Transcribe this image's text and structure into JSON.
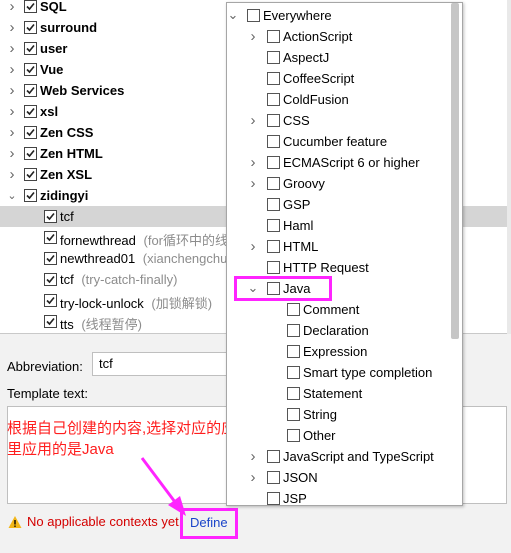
{
  "tree": {
    "items": [
      {
        "label": "SQL",
        "bold": true,
        "checked": true,
        "expanded": false
      },
      {
        "label": "surround",
        "bold": true,
        "checked": true,
        "expanded": false
      },
      {
        "label": "user",
        "bold": true,
        "checked": true,
        "expanded": false
      },
      {
        "label": "Vue",
        "bold": true,
        "checked": true,
        "expanded": false
      },
      {
        "label": "Web Services",
        "bold": true,
        "checked": true,
        "expanded": false
      },
      {
        "label": "xsl",
        "bold": true,
        "checked": true,
        "expanded": false
      },
      {
        "label": "Zen CSS",
        "bold": true,
        "checked": true,
        "expanded": false
      },
      {
        "label": "Zen HTML",
        "bold": true,
        "checked": true,
        "expanded": false
      },
      {
        "label": "Zen XSL",
        "bold": true,
        "checked": true,
        "expanded": false
      },
      {
        "label": "zidingyi",
        "bold": true,
        "checked": true,
        "expanded": true
      }
    ],
    "children": [
      {
        "label": "tcf",
        "desc": "",
        "selected": true
      },
      {
        "label": "fornewthread",
        "desc": "(for循环中的线",
        "selected": false
      },
      {
        "label": "newthread01",
        "desc": "(xianchengchua",
        "selected": false
      },
      {
        "label": "tcf",
        "desc": "(try-catch-finally)",
        "selected": false
      },
      {
        "label": "try-lock-unlock",
        "desc": "(加锁解锁)",
        "selected": false
      },
      {
        "label": "tts",
        "desc": "(线程暂停)",
        "selected": false
      }
    ]
  },
  "form": {
    "abbreviation_label": "Abbreviation:",
    "abbreviation_value": "tcf",
    "template_label": "Template text:",
    "annotation": "根据自己创建的内容,选择对应的应用,这里应用的是Java",
    "warning": "No applicable contexts yet.",
    "define_link": "Define"
  },
  "contexts": {
    "root": {
      "label": "Everywhere"
    },
    "items": [
      {
        "label": "ActionScript",
        "expandable": true
      },
      {
        "label": "AspectJ",
        "expandable": false
      },
      {
        "label": "CoffeeScript",
        "expandable": false
      },
      {
        "label": "ColdFusion",
        "expandable": false
      },
      {
        "label": "CSS",
        "expandable": true
      },
      {
        "label": "Cucumber feature",
        "expandable": false
      },
      {
        "label": "ECMAScript 6 or higher",
        "expandable": true
      },
      {
        "label": "Groovy",
        "expandable": true
      },
      {
        "label": "GSP",
        "expandable": false
      },
      {
        "label": "Haml",
        "expandable": false
      },
      {
        "label": "HTML",
        "expandable": true
      },
      {
        "label": "HTTP Request",
        "expandable": false
      },
      {
        "label": "Java",
        "expandable": true,
        "expanded": true
      }
    ],
    "java_children": [
      {
        "label": "Comment"
      },
      {
        "label": "Declaration"
      },
      {
        "label": "Expression"
      },
      {
        "label": "Smart type completion"
      },
      {
        "label": "Statement"
      },
      {
        "label": "String"
      },
      {
        "label": "Other"
      }
    ],
    "after_items": [
      {
        "label": "JavaScript and TypeScript",
        "expandable": true
      },
      {
        "label": "JSON",
        "expandable": true
      },
      {
        "label": "JSP",
        "expandable": false
      }
    ]
  },
  "colors": {
    "highlight": "#ff24ff",
    "annotation": "#ff1e1e",
    "warning": "#d40000",
    "link": "#1a44c9",
    "selected_row": "#d5d5d5"
  }
}
